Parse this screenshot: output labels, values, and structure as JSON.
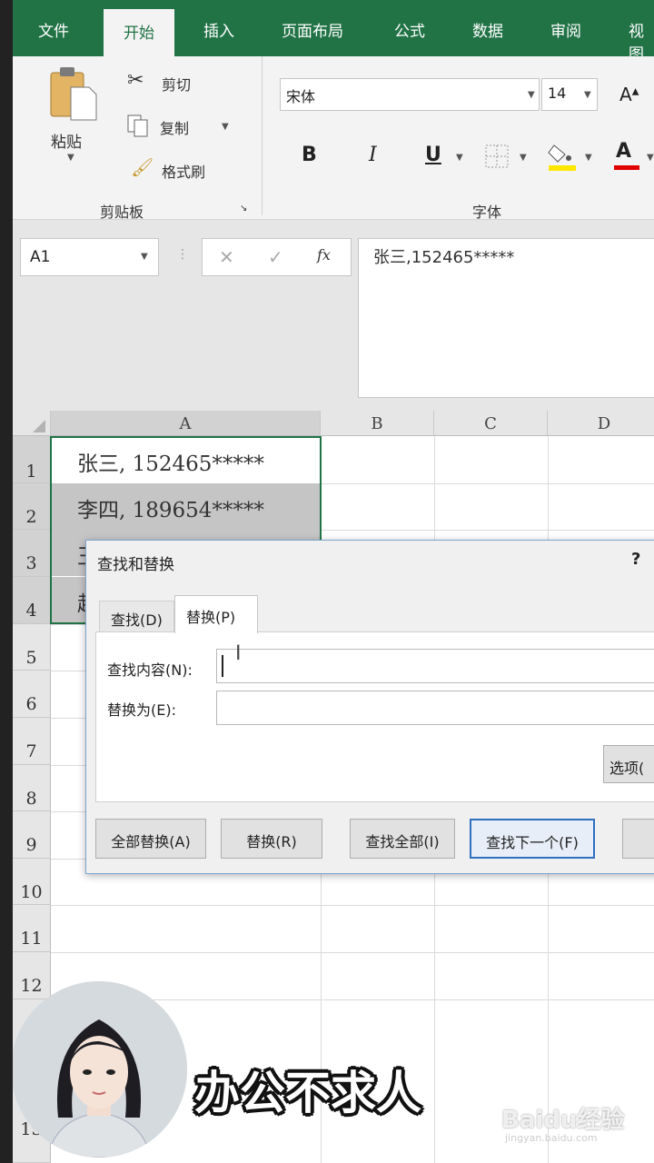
{
  "ribbon_tabs": [
    "文件",
    "开始",
    "插入",
    "页面布局",
    "公式",
    "数据",
    "审阅",
    "视图"
  ],
  "clipboard": {
    "paste_label": "粘贴",
    "cut_label": "剪切",
    "copy_label": "复制",
    "format_painter_label": "格式刷",
    "group_label": "剪贴板"
  },
  "font_group": {
    "font_name": "宋体",
    "font_size": "14",
    "group_label": "字体",
    "bold": "B",
    "italic": "I",
    "underline": "U",
    "font_color_glyph": "A"
  },
  "formula_bar": {
    "name_box": "A1",
    "cancel_glyph": "✕",
    "enter_glyph": "✓",
    "fx_label": "fx",
    "content": "张三,152465*****"
  },
  "sheet": {
    "columns": [
      "A",
      "B",
      "C",
      "D"
    ],
    "rows": [
      "1",
      "2",
      "3",
      "4",
      "5",
      "6",
      "7",
      "8",
      "9",
      "10",
      "11",
      "12",
      "15"
    ],
    "cells": [
      "张三, 152465*****",
      "李四, 189654*****",
      "王",
      "赵"
    ]
  },
  "dialog": {
    "title": "查找和替换",
    "help": "?",
    "tab_find": "查找(D)",
    "tab_replace": "替换(P)",
    "find_label": "查找内容(N):",
    "replace_label": "替换为(E):",
    "options_button": "选项(",
    "buttons": {
      "replace_all": "全部替换(A)",
      "replace": "替换(R)",
      "find_all": "查找全部(I)",
      "find_next": "查找下一个(F)"
    }
  },
  "overlay": {
    "slogan": "办公不求人",
    "watermark": "Baidu经验",
    "watermark_sub": "jingyan.baidu.com"
  }
}
